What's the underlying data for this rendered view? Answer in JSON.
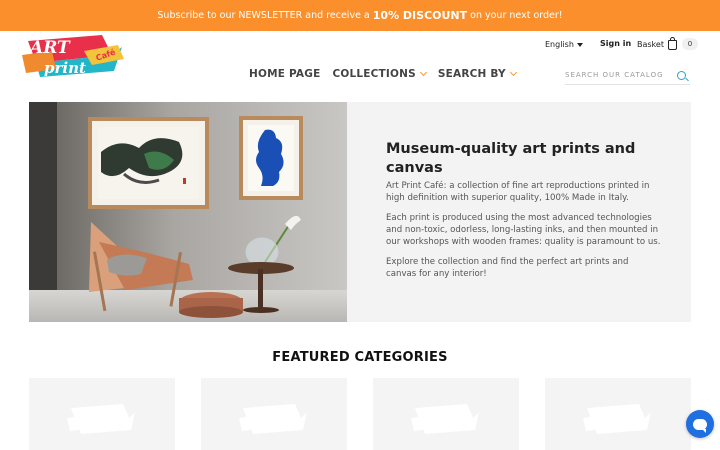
{
  "promo": {
    "before": "Subscribe to our NEWSLETTER and receive a",
    "highlight": "10% DISCOUNT",
    "after": "on your next order!",
    "background": "#fb8f2c"
  },
  "logo": {
    "line1": "ART",
    "line2": "print",
    "line3": "Café"
  },
  "util": {
    "language": "English",
    "signin": "Sign in",
    "basket": "Basket",
    "basket_count": "0"
  },
  "nav": {
    "home": "HOME PAGE",
    "collections": "COLLECTIONS",
    "search_by": "SEARCH BY"
  },
  "search": {
    "placeholder": "SEARCH OUR CATALOG"
  },
  "hero": {
    "title": "Museum-quality art prints and canvas",
    "p1": "Art Print Café: a collection of fine art reproductions printed in high definition with superior quality, 100% Made in Italy.",
    "p2": "Each print is produced using the most advanced technologies and non-toxic, odorless, long-lasting inks, and then mounted in our workshops with wooden frames: quality is paramount to us.",
    "p3": "Explore the collection and find the perfect art prints and canvas for any interior!"
  },
  "featured": {
    "title": "FEATURED CATEGORIES"
  },
  "colors": {
    "accent": "#fb8f2c",
    "search_icon": "#29a3c6",
    "chat": "#1f6fe0"
  }
}
